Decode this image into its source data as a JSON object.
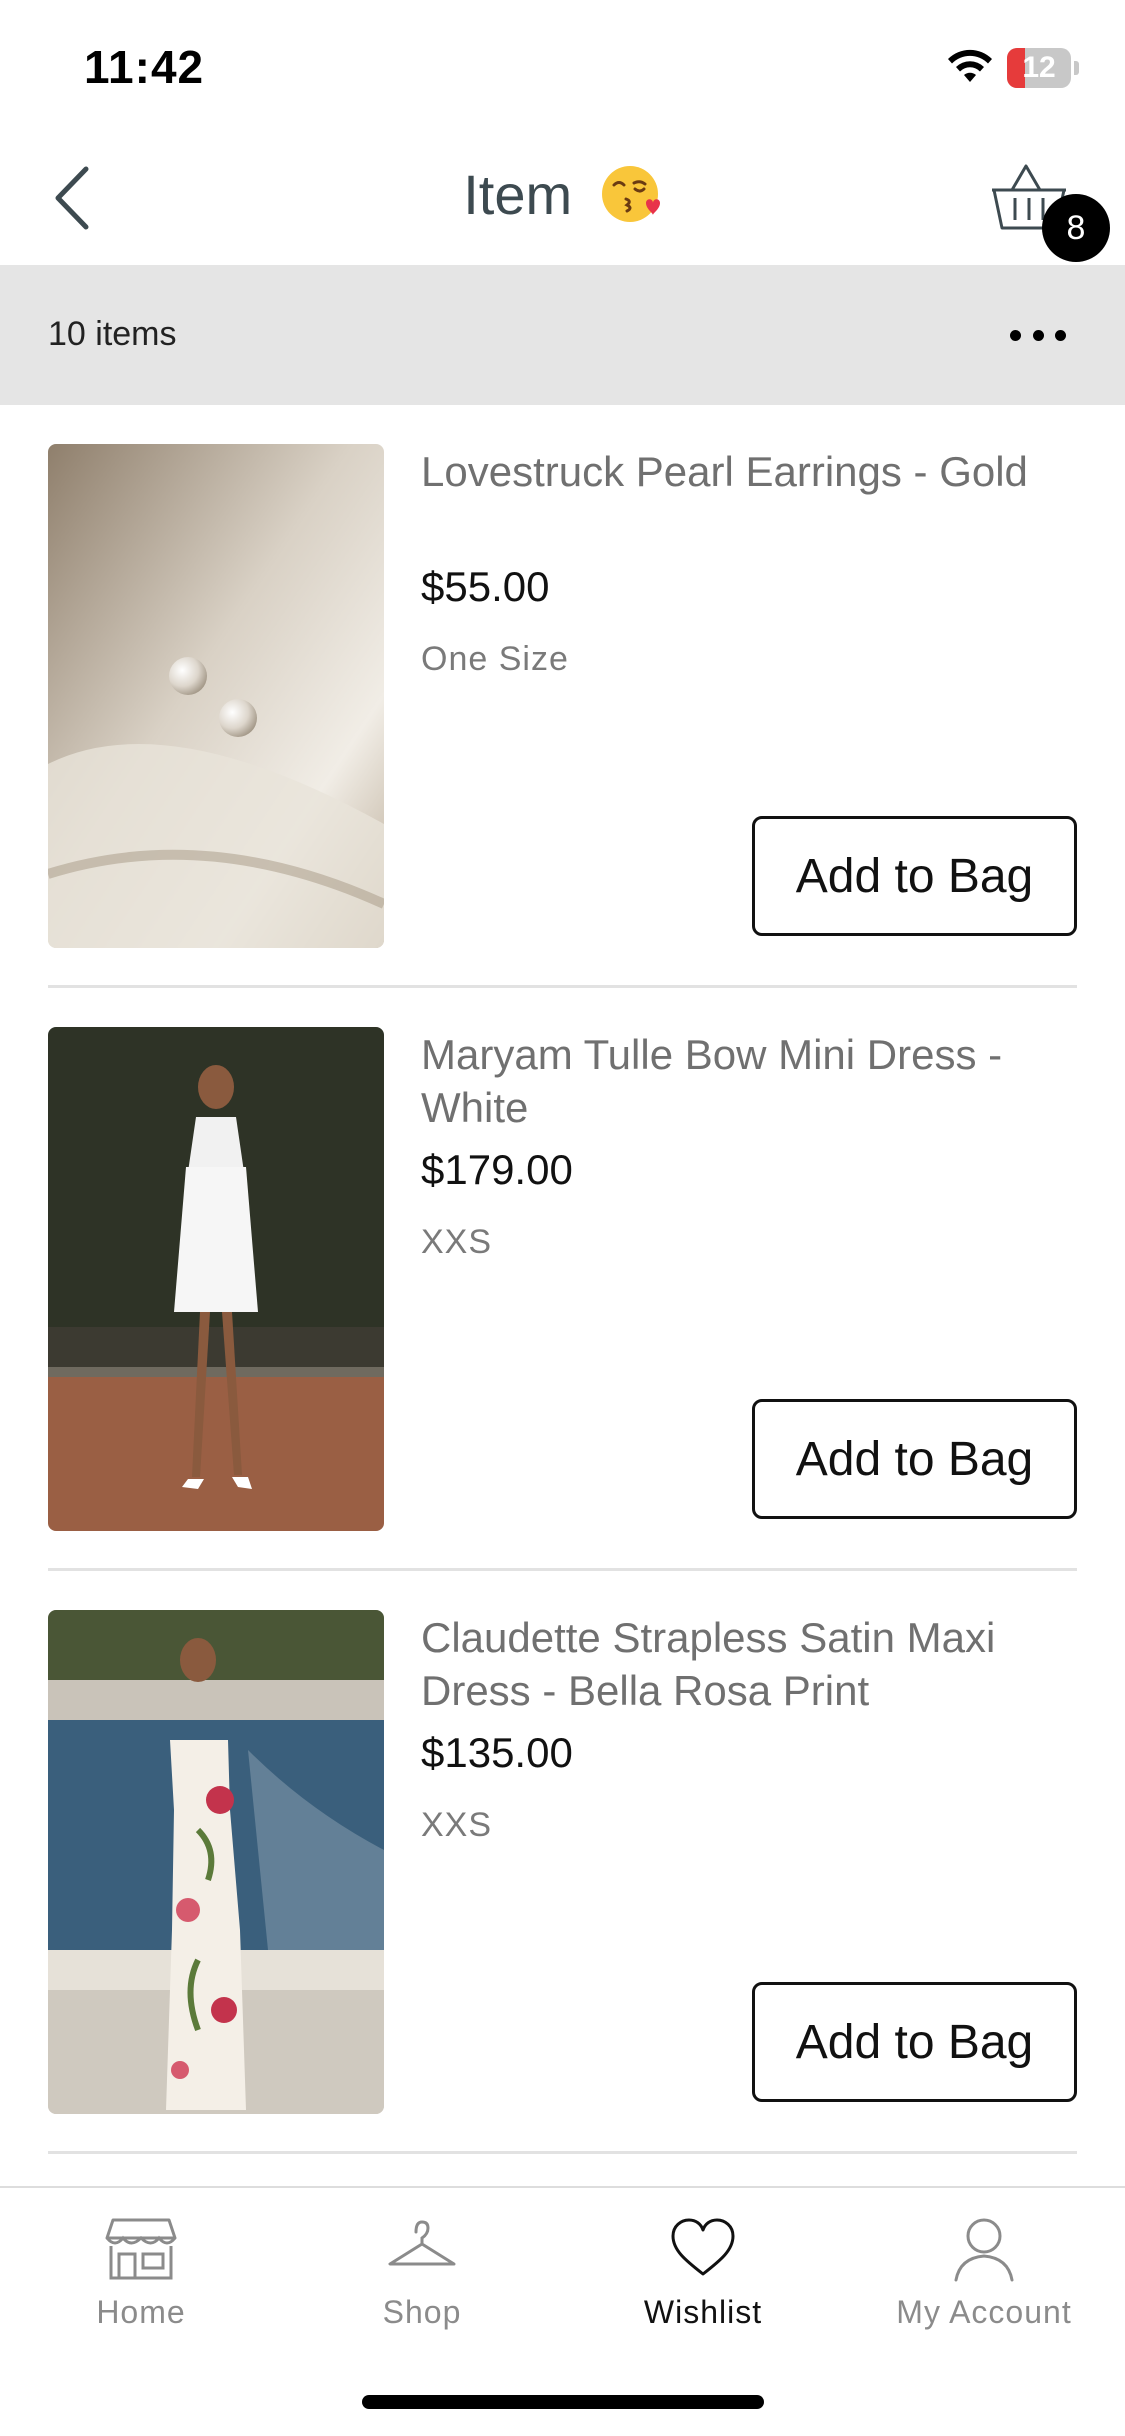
{
  "status_bar": {
    "time": "11:42",
    "battery_level": "12",
    "battery_fraction": 0.12,
    "battery_color": "#e63b3b"
  },
  "header": {
    "title": "Item",
    "title_emoji_icon": "face-blowing-kiss-icon",
    "back_icon": "chevron-left-icon",
    "cart_icon": "basket-icon",
    "cart_count": "8"
  },
  "toolbar": {
    "item_count": "10 items",
    "more_icon": "more-horizontal-icon"
  },
  "items": [
    {
      "name": "Lovestruck Pearl Earrings - Gold",
      "price": "$55.00",
      "size": "One Size",
      "add_label": "Add to Bag"
    },
    {
      "name": "Maryam Tulle Bow Mini Dress - White",
      "price": "$179.00",
      "size": "XXS",
      "add_label": "Add to Bag"
    },
    {
      "name": "Claudette Strapless Satin Maxi Dress - Bella Rosa Print",
      "price": "$135.00",
      "size": "XXS",
      "add_label": "Add to Bag"
    }
  ],
  "tab_bar": {
    "tabs": [
      {
        "label": "Home",
        "icon": "storefront-icon",
        "active": false
      },
      {
        "label": "Shop",
        "icon": "hanger-icon",
        "active": false
      },
      {
        "label": "Wishlist",
        "icon": "heart-icon",
        "active": true
      },
      {
        "label": "My Account",
        "icon": "person-icon",
        "active": false
      }
    ]
  }
}
